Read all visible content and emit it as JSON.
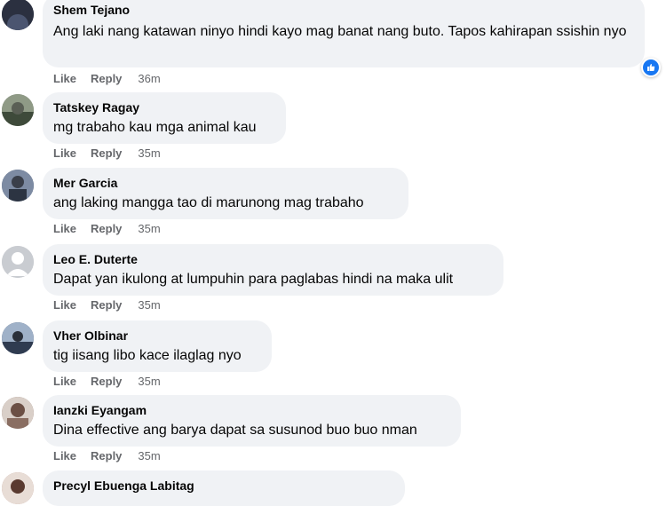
{
  "comments": [
    {
      "name": "Shem Tejano",
      "text": "Ang laki nang katawan ninyo hindi kayo mag banat nang buto. Tapos kahirapan ssishin nyo",
      "like": "Like",
      "reply": "Reply",
      "time": "36m",
      "avatar_color": "#2b3040"
    },
    {
      "name": "Tatskey Ragay",
      "text": "mg trabaho kau mga animal kau",
      "like": "Like",
      "reply": "Reply",
      "time": "35m",
      "avatar_color": "#6d7a6a"
    },
    {
      "name": "Mer Garcia",
      "text": "ang laking mangga tao di marunong mag trabaho",
      "like": "Like",
      "reply": "Reply",
      "time": "35m",
      "avatar_color": "#4a5a74"
    },
    {
      "name": "Leo E. Duterte",
      "text": "Dapat yan ikulong at lumpuhin para paglabas hindi na maka ulit",
      "like": "Like",
      "reply": "Reply",
      "time": "35m",
      "avatar_color": "#c9ccd1"
    },
    {
      "name": "Vher Olbinar",
      "text": "tig iisang libo kace ilaglag nyo",
      "like": "Like",
      "reply": "Reply",
      "time": "35m",
      "avatar_color": "#3d4c66"
    },
    {
      "name": "Ianzki Eyangam",
      "text": "Dina effective ang barya dapat sa susunod buo buo nman",
      "like": "Like",
      "reply": "Reply",
      "time": "35m",
      "avatar_color": "#8a6e62"
    },
    {
      "name": "Precyl Ebuenga Labitag",
      "text": "",
      "avatar_color": "#b98d80"
    }
  ],
  "reaction_icon": "like-thumb-icon",
  "colors": {
    "bubble": "#f0f2f5",
    "meta": "#65676b",
    "like_blue": "#1877f2"
  }
}
